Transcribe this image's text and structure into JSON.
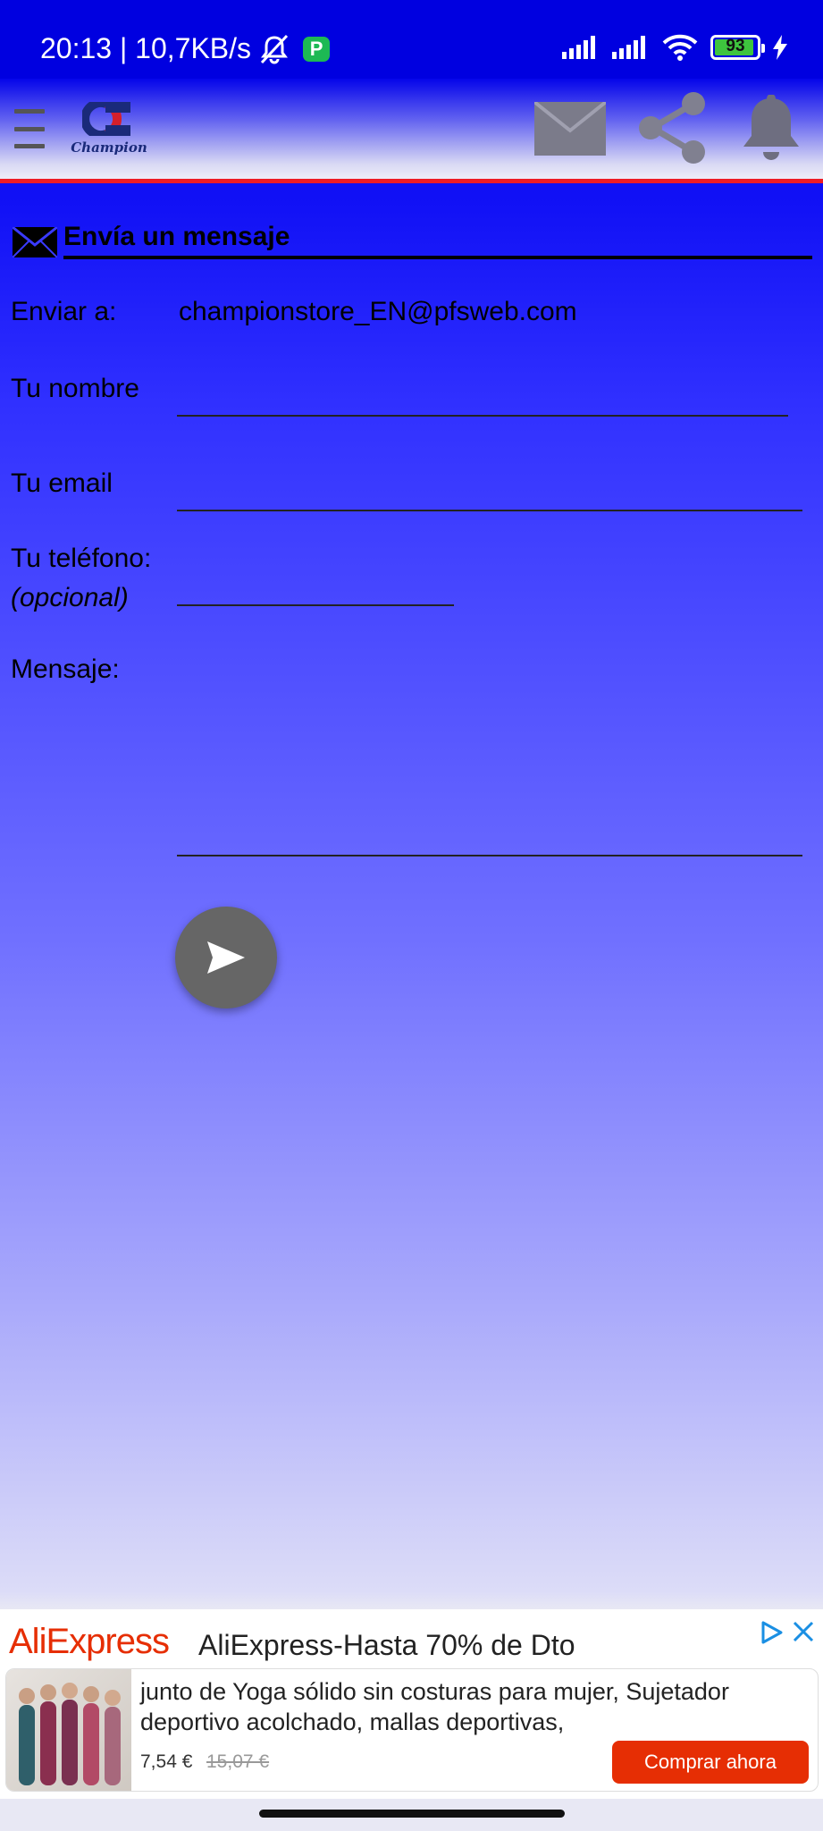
{
  "status_bar": {
    "time_speed": "20:13 | 10,7KB/s",
    "p_badge": "P",
    "battery": "93",
    "battery_level": 0.93
  },
  "header": {
    "logo_text": "Champion"
  },
  "form": {
    "title": "Envía un mensaje",
    "send_to_label": "Enviar a:",
    "send_to_value": "championstore_EN@pfsweb.com",
    "name_label": "Tu nombre",
    "email_label": "Tu email",
    "phone_label": "Tu teléfono:",
    "phone_hint": "(opcional)",
    "message_label": "Mensaje:"
  },
  "ad": {
    "brand": "AliExpress",
    "headline": "AliExpress-Hasta 70% de Dto",
    "description": "junto de Yoga sólido sin costuras para mujer, Sujetador deportivo acolchado, mallas deportivas,",
    "price": "7,54 €",
    "old_price": "15,07 €",
    "cta": "Comprar ahora"
  },
  "colors": {
    "accent_red": "#ee1c25",
    "ali_red": "#e62e04",
    "primary_blue": "#0000e6"
  }
}
